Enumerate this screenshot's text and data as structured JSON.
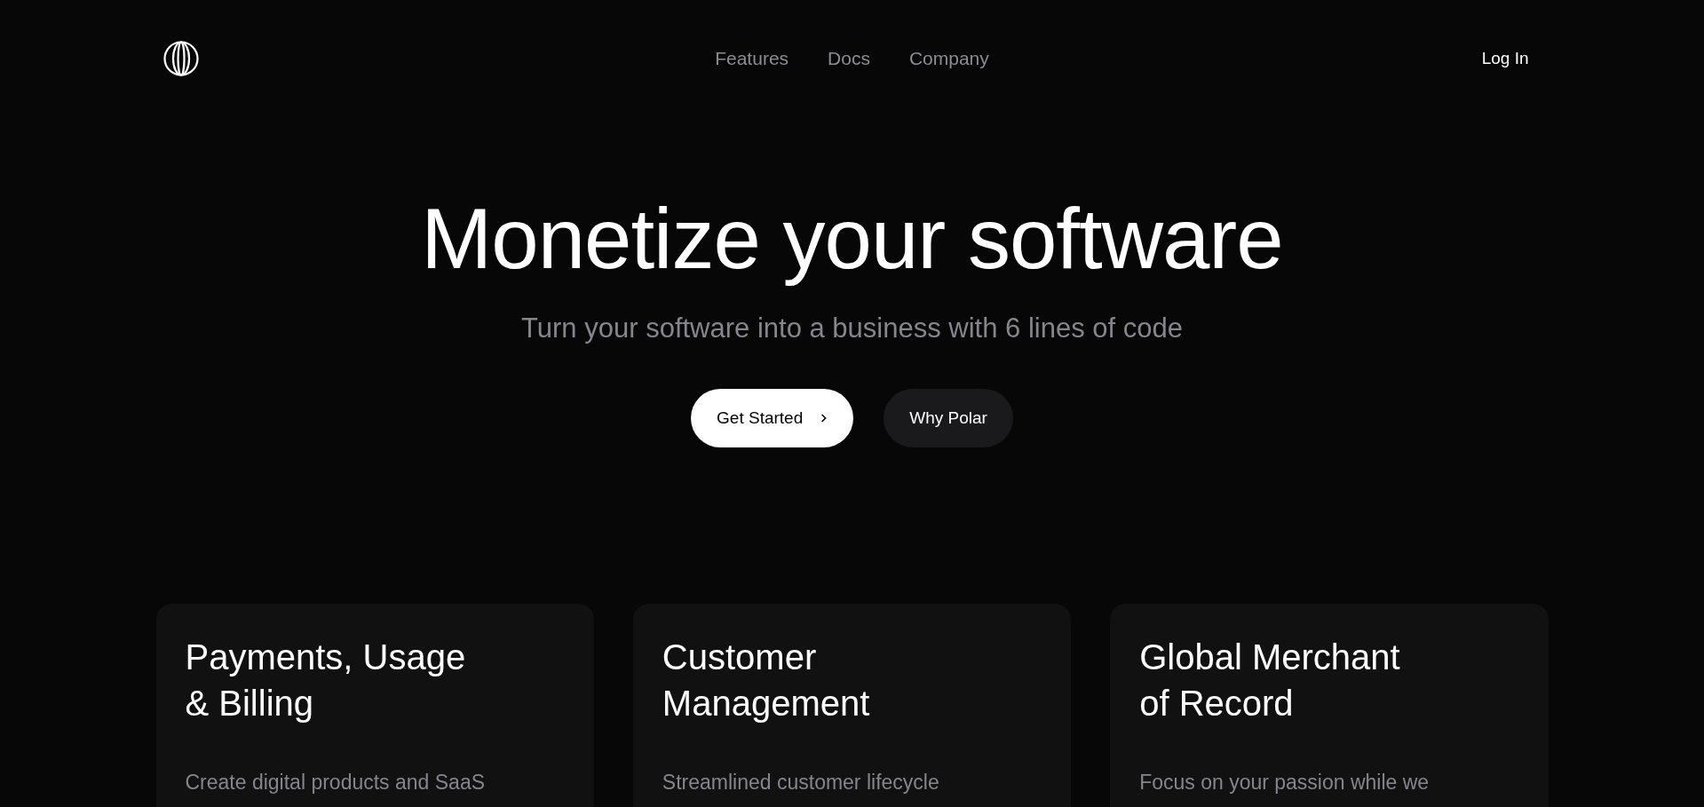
{
  "nav": {
    "links": [
      "Features",
      "Docs",
      "Company"
    ],
    "login": "Log In"
  },
  "hero": {
    "title": "Monetize your software",
    "subtitle": "Turn your software into a business with 6 lines of code",
    "primary_button": "Get Started",
    "secondary_button": "Why Polar"
  },
  "cards": [
    {
      "title": "Payments, Usage\n& Billing",
      "description": "Create digital products and SaaS"
    },
    {
      "title": "Customer\nManagement",
      "description": "Streamlined customer lifecycle"
    },
    {
      "title": "Global Merchant\nof Record",
      "description": "Focus on your passion while we"
    }
  ]
}
